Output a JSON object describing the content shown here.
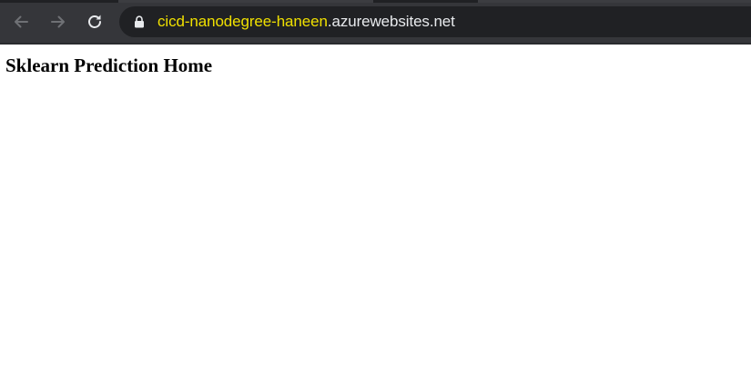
{
  "browser": {
    "address_bar": {
      "url_highlight": "cicd-nanodegree-haneen",
      "url_rest": ".azurewebsites.net"
    },
    "buttons": {
      "back_icon": "arrow-left-icon",
      "forward_icon": "arrow-right-icon",
      "reload_icon": "reload-icon",
      "lock_icon": "lock-icon"
    }
  },
  "page": {
    "title": "Sklearn Prediction Home"
  },
  "colors": {
    "toolbar": "#35363a",
    "omnibox": "#202124",
    "url_highlight": "#f0e000",
    "url_text": "#e8eaed"
  }
}
